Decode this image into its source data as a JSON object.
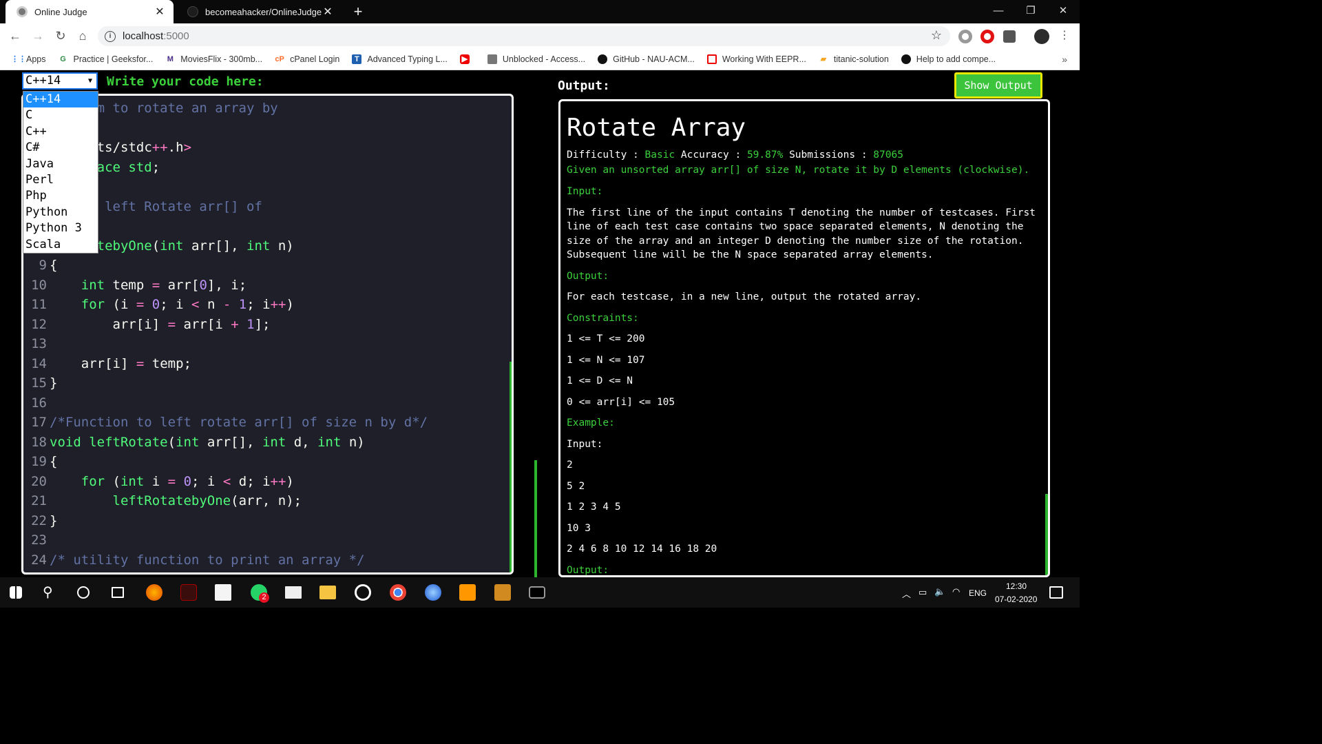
{
  "browser": {
    "tabs": [
      {
        "title": "Online Judge",
        "active": true
      },
      {
        "title": "becomeahacker/OnlineJudge",
        "active": false
      }
    ],
    "new_tab_glyph": "+",
    "window_controls": [
      "—",
      "❐",
      "✕"
    ],
    "url_host": "localhost",
    "url_port": ":5000",
    "bookmarks": [
      {
        "label": "Apps",
        "icon": "apps-grid-icon"
      },
      {
        "label": "Practice | Geeksfor...",
        "icon": "geeksforgeeks-icon"
      },
      {
        "label": "MoviesFlix - 300mb...",
        "icon": "moviesflix-icon"
      },
      {
        "label": "cPanel Login",
        "icon": "cpanel-icon"
      },
      {
        "label": "Advanced Typing L...",
        "icon": "typing-icon"
      },
      {
        "label": "",
        "icon": "youtube-icon"
      },
      {
        "label": "Unblocked - Access...",
        "icon": "unblocked-icon"
      },
      {
        "label": "GitHub - NAU-ACM...",
        "icon": "github-icon"
      },
      {
        "label": "Working With EEPR...",
        "icon": "eepr-icon"
      },
      {
        "label": "titanic-solution",
        "icon": "kaggle-icon"
      },
      {
        "label": "Help to add compe...",
        "icon": "github-icon"
      }
    ],
    "bookmarks_more": "»"
  },
  "editor": {
    "selected_language": "C++14",
    "languages": [
      "C++14",
      "C",
      "C++",
      "C#",
      "Java",
      "Perl",
      "Php",
      "Python",
      "Python 3",
      "Scala"
    ],
    "write_label": "Write your code here:",
    "lines": [
      {
        "n": "",
        "text": "program to rotate an array by"
      },
      {
        "n": "",
        "text": "ements"
      },
      {
        "n": "",
        "text": "le <bits/stdc++.h>"
      },
      {
        "n": "",
        "text": "namespace std;"
      },
      {
        "n": "",
        "text": ""
      },
      {
        "n": "",
        "text": "ion to left Rotate arr[] of"
      },
      {
        "n": "",
        "text": "by 1*/"
      },
      {
        "n": "",
        "text": "ftRotatebyOne(int arr[], int n)"
      },
      {
        "n": "9",
        "text": "{"
      },
      {
        "n": "10",
        "text": "    int temp = arr[0], i;"
      },
      {
        "n": "11",
        "text": "    for (i = 0; i < n - 1; i++)"
      },
      {
        "n": "12",
        "text": "        arr[i] = arr[i + 1];"
      },
      {
        "n": "13",
        "text": ""
      },
      {
        "n": "14",
        "text": "    arr[i] = temp;"
      },
      {
        "n": "15",
        "text": "}"
      },
      {
        "n": "16",
        "text": ""
      },
      {
        "n": "17",
        "text": "/*Function to left rotate arr[] of size n by d*/"
      },
      {
        "n": "18",
        "text": "void leftRotate(int arr[], int d, int n)"
      },
      {
        "n": "19",
        "text": "{"
      },
      {
        "n": "20",
        "text": "    for (int i = 0; i < d; i++)"
      },
      {
        "n": "21",
        "text": "        leftRotatebyOne(arr, n);"
      },
      {
        "n": "22",
        "text": "}"
      },
      {
        "n": "23",
        "text": ""
      },
      {
        "n": "24",
        "text": "/* utility function to print an array */"
      }
    ]
  },
  "output": {
    "label": "Output:",
    "show_button": "Show Output",
    "title": "Rotate Array",
    "difficulty_label": "Difficulty :",
    "difficulty": "Basic",
    "accuracy_label": "Accuracy :",
    "accuracy": "59.87%",
    "submissions_label": "Submissions :",
    "submissions": "87065",
    "summary": "Given an unsorted array arr[] of size N, rotate it by D elements (clockwise).",
    "input_heading": "Input:",
    "input_text": "The first line of the input contains T denoting the number of testcases. First line of each test case contains two space separated elements, N denoting the size of the array and an integer D denoting the number size of the rotation. Subsequent line will be the N space separated array elements.",
    "output_heading": "Output:",
    "output_text": "For each testcase, in a new line, output the rotated array.",
    "constraints_heading": "Constraints:",
    "constraints": [
      "1 <= T <= 200",
      "1 <= N <= 107",
      "1 <= D <= N",
      "0 <= arr[i] <= 105"
    ],
    "example_heading": "Example:",
    "example_input_label": "Input:",
    "example_lines": [
      "2",
      "5 2",
      "1 2 3 4 5",
      "10 3",
      "2 4 6 8 10 12 14 16 18 20"
    ],
    "example_output_heading": "Output:"
  },
  "taskbar": {
    "language": "ENG",
    "time": "12:30",
    "date": "07-02-2020",
    "whatsapp_badge": "2"
  }
}
